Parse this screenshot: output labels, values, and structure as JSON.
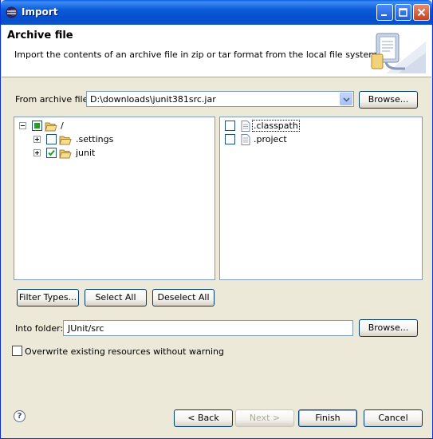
{
  "window": {
    "title": "Import"
  },
  "banner": {
    "title": "Archive file",
    "description": "Import the contents of an archive file in zip or tar format from the local file system."
  },
  "archive": {
    "label": "From archive file:",
    "value": "D:\\downloads\\junit381src.jar",
    "browse_label": "Browse..."
  },
  "tree": {
    "items": [
      {
        "label": "/",
        "expander": "minus",
        "check": "partial"
      },
      {
        "label": ".settings",
        "expander": "plus",
        "check": "unchecked"
      },
      {
        "label": "junit",
        "expander": "plus",
        "check": "checked"
      }
    ]
  },
  "files": {
    "items": [
      {
        "label": ".classpath",
        "check": "unchecked"
      },
      {
        "label": ".project",
        "check": "unchecked"
      }
    ]
  },
  "selection_buttons": {
    "filter_types": "Filter Types...",
    "select_all": "Select All",
    "deselect_all": "Deselect All"
  },
  "into_folder": {
    "label": "Into folder:",
    "value": "JUnit/src",
    "browse_label": "Browse..."
  },
  "overwrite": {
    "label": "Overwrite existing resources without warning",
    "checked": false
  },
  "footer": {
    "back": "< Back",
    "next": "Next >",
    "finish": "Finish",
    "cancel": "Cancel"
  },
  "colors": {
    "titlebar": "#0b5bd8",
    "window_bg": "#ece9d8",
    "checkmark": "#21a121"
  }
}
